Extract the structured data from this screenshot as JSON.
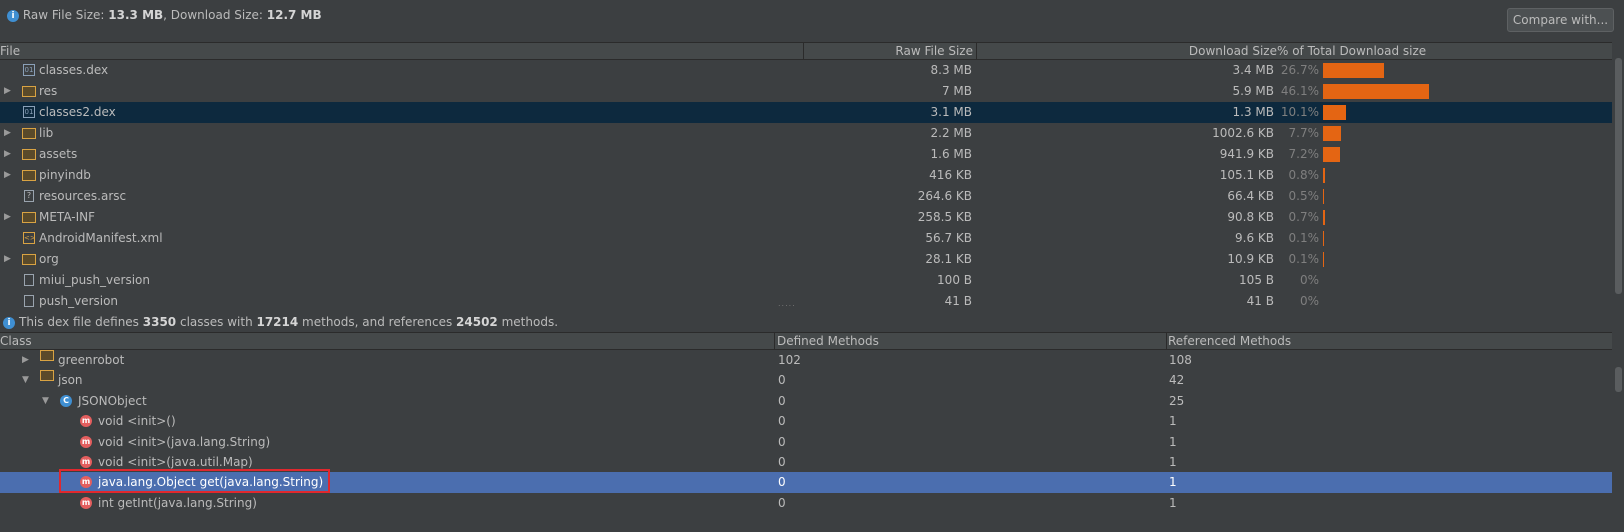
{
  "top": {
    "raw_label": "Raw File Size: ",
    "raw_value": "13.3 MB",
    "download_label": ", Download Size: ",
    "download_value": "12.7 MB",
    "compare_button": "Compare with..."
  },
  "file_table": {
    "headers": {
      "file": "File",
      "raw": "Raw File Size",
      "download": "Download Size",
      "percent": "% of Total Download size"
    },
    "rows": [
      {
        "name": "classes.dex",
        "raw": "8.3 MB",
        "download": "3.4 MB",
        "percent": "26.7%",
        "share": 0.267,
        "icon": "dex-file-icon",
        "expandable": false
      },
      {
        "name": "res",
        "raw": "7 MB",
        "download": "5.9 MB",
        "percent": "46.1%",
        "share": 0.461,
        "icon": "folder-icon",
        "expandable": true
      },
      {
        "name": "classes2.dex",
        "raw": "3.1 MB",
        "download": "1.3 MB",
        "percent": "10.1%",
        "share": 0.101,
        "icon": "dex-file-icon",
        "expandable": false,
        "selected": true
      },
      {
        "name": "lib",
        "raw": "2.2 MB",
        "download": "1002.6 KB",
        "percent": "7.7%",
        "share": 0.077,
        "icon": "folder-icon",
        "expandable": true
      },
      {
        "name": "assets",
        "raw": "1.6 MB",
        "download": "941.9 KB",
        "percent": "7.2%",
        "share": 0.072,
        "icon": "folder-icon",
        "expandable": true
      },
      {
        "name": "pinyindb",
        "raw": "416 KB",
        "download": "105.1 KB",
        "percent": "0.8%",
        "share": 0.008,
        "icon": "folder-icon",
        "expandable": true
      },
      {
        "name": "resources.arsc",
        "raw": "264.6 KB",
        "download": "66.4 KB",
        "percent": "0.5%",
        "share": 0.005,
        "icon": "unknown-file-icon",
        "expandable": false
      },
      {
        "name": "META-INF",
        "raw": "258.5 KB",
        "download": "90.8 KB",
        "percent": "0.7%",
        "share": 0.007,
        "icon": "folder-icon",
        "expandable": true
      },
      {
        "name": "AndroidManifest.xml",
        "raw": "56.7 KB",
        "download": "9.6 KB",
        "percent": "0.1%",
        "share": 0.001,
        "icon": "xml-file-icon",
        "expandable": false
      },
      {
        "name": "org",
        "raw": "28.1 KB",
        "download": "10.9 KB",
        "percent": "0.1%",
        "share": 0.001,
        "icon": "folder-icon",
        "expandable": true
      },
      {
        "name": "miui_push_version",
        "raw": "100 B",
        "download": "105 B",
        "percent": "0%",
        "share": 0,
        "icon": "text-file-icon",
        "expandable": false
      },
      {
        "name": "push_version",
        "raw": "41 B",
        "download": "41 B",
        "percent": "0%",
        "share": 0,
        "icon": "text-file-icon",
        "expandable": false
      }
    ]
  },
  "dex_info": {
    "prefix": "This dex file defines ",
    "classes": "3350",
    "mid1": " classes with ",
    "methods": "17214",
    "mid2": " methods, and references ",
    "refs": "24502",
    "suffix": " methods."
  },
  "class_table": {
    "headers": {
      "class": "Class",
      "defined": "Defined Methods",
      "referenced": "Referenced Methods"
    },
    "rows": [
      {
        "name": "greenrobot",
        "defined": "102",
        "referenced": "108",
        "kind": "package",
        "depth": 1,
        "arrow": "right"
      },
      {
        "name": "json",
        "defined": "0",
        "referenced": "42",
        "kind": "package",
        "depth": 1,
        "arrow": "down"
      },
      {
        "name": "JSONObject",
        "defined": "0",
        "referenced": "25",
        "kind": "class",
        "depth": 2,
        "arrow": "down"
      },
      {
        "name": "void <init>()",
        "defined": "0",
        "referenced": "1",
        "kind": "method",
        "depth": 3
      },
      {
        "name": "void <init>(java.lang.String)",
        "defined": "0",
        "referenced": "1",
        "kind": "method",
        "depth": 3
      },
      {
        "name": "void <init>(java.util.Map)",
        "defined": "0",
        "referenced": "1",
        "kind": "method",
        "depth": 3
      },
      {
        "name": "java.lang.Object get(java.lang.String)",
        "defined": "0",
        "referenced": "1",
        "kind": "method",
        "depth": 3,
        "selected": true
      },
      {
        "name": "int getInt(java.lang.String)",
        "defined": "0",
        "referenced": "1",
        "kind": "method",
        "depth": 3
      }
    ]
  },
  "colors": {
    "background": "#3c3f41",
    "bar": "#e46513",
    "selection_file": "#0d293e",
    "selection_class": "#4b6eaf",
    "highlight_box": "#e0282e"
  }
}
